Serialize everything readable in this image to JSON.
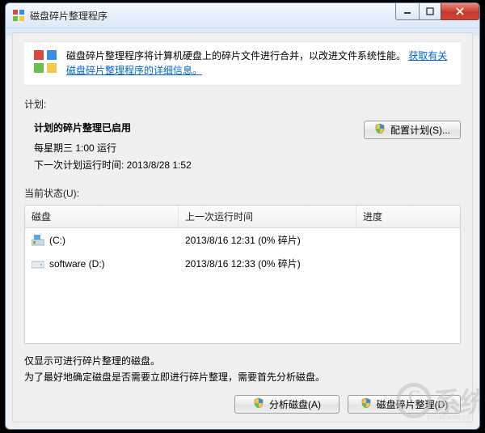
{
  "window": {
    "title": "磁盘碎片整理程序"
  },
  "info": {
    "text": "磁盘碎片整理程序将计算机硬盘上的碎片文件进行合并，以改进文件系统性能。",
    "link": "获取有关磁盘碎片整理程序的详细信息。"
  },
  "schedule": {
    "section_label": "计划:",
    "heading": "计划的碎片整理已启用",
    "line1": "每星期三  1:00 运行",
    "line2": "下一次计划运行时间: 2013/8/28 1:52",
    "configure_btn": "配置计划(S)..."
  },
  "status": {
    "section_label": "当前状态(U):",
    "columns": {
      "disk": "磁盘",
      "last_run": "上一次运行时间",
      "progress": "进度"
    },
    "rows": [
      {
        "name": "(C:)",
        "last_run": "2013/8/16 12:31 (0% 碎片)",
        "progress": "",
        "icon": "os-drive"
      },
      {
        "name": "software (D:)",
        "last_run": "2013/8/16 12:33 (0% 碎片)",
        "progress": "",
        "icon": "drive"
      }
    ]
  },
  "notes": {
    "line1": "仅显示可进行碎片整理的磁盘。",
    "line2": "为了最好地确定磁盘是否需要立即进行碎片整理，需要首先分析磁盘。"
  },
  "buttons": {
    "analyze": "分析磁盘(A)",
    "defrag": "磁盘碎片整理(D)"
  },
  "watermark": {
    "text": "系统",
    "sub": "xr/oucieno.co"
  }
}
